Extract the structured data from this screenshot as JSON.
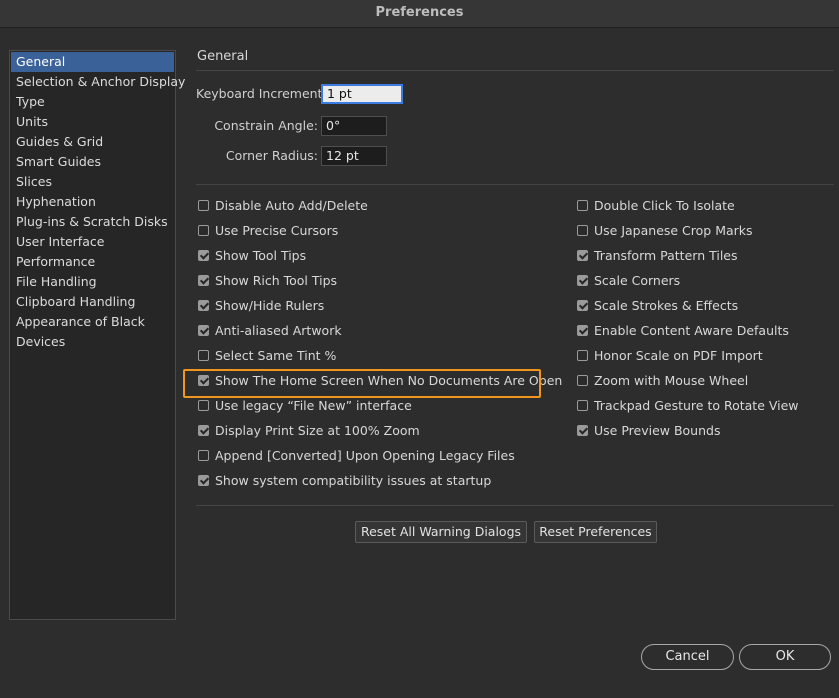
{
  "window": {
    "title": "Preferences"
  },
  "sidebar": {
    "items": [
      {
        "label": "General",
        "selected": true
      },
      {
        "label": "Selection & Anchor Display"
      },
      {
        "label": "Type"
      },
      {
        "label": "Units"
      },
      {
        "label": "Guides & Grid"
      },
      {
        "label": "Smart Guides"
      },
      {
        "label": "Slices"
      },
      {
        "label": "Hyphenation"
      },
      {
        "label": "Plug-ins & Scratch Disks"
      },
      {
        "label": "User Interface"
      },
      {
        "label": "Performance"
      },
      {
        "label": "File Handling"
      },
      {
        "label": "Clipboard Handling"
      },
      {
        "label": "Appearance of Black"
      },
      {
        "label": "Devices"
      }
    ]
  },
  "general": {
    "title": "General",
    "keyboard_increment": {
      "label": "Keyboard Increment:",
      "value": "1 pt"
    },
    "constrain_angle": {
      "label": "Constrain Angle:",
      "value": "0°"
    },
    "corner_radius": {
      "label": "Corner Radius:",
      "value": "12 pt"
    }
  },
  "options_left": [
    {
      "label": "Disable Auto Add/Delete",
      "checked": false
    },
    {
      "label": "Use Precise Cursors",
      "checked": false
    },
    {
      "label": "Show Tool Tips",
      "checked": true
    },
    {
      "label": "Show Rich Tool Tips",
      "checked": true
    },
    {
      "label": "Show/Hide Rulers",
      "checked": true
    },
    {
      "label": "Anti-aliased Artwork",
      "checked": true
    },
    {
      "label": "Select Same Tint %",
      "checked": false
    },
    {
      "label": "Show The Home Screen When No Documents Are Open",
      "checked": true
    },
    {
      "label": "Use legacy “File New” interface",
      "checked": false
    },
    {
      "label": "Display Print Size at 100% Zoom",
      "checked": true
    },
    {
      "label": "Append [Converted] Upon Opening Legacy Files",
      "checked": false
    },
    {
      "label": "Show system compatibility issues at startup",
      "checked": true
    }
  ],
  "options_right": [
    {
      "label": "Double Click To Isolate",
      "checked": false
    },
    {
      "label": "Use Japanese Crop Marks",
      "checked": false
    },
    {
      "label": "Transform Pattern Tiles",
      "checked": true
    },
    {
      "label": "Scale Corners",
      "checked": true
    },
    {
      "label": "Scale Strokes & Effects",
      "checked": true
    },
    {
      "label": "Enable Content Aware Defaults",
      "checked": true
    },
    {
      "label": "Honor Scale on PDF Import",
      "checked": false
    },
    {
      "label": "Zoom with Mouse Wheel",
      "checked": false
    },
    {
      "label": "Trackpad Gesture to Rotate View",
      "checked": false
    },
    {
      "label": "Use Preview Bounds",
      "checked": true
    }
  ],
  "buttons": {
    "reset_warnings": "Reset All Warning Dialogs",
    "reset_prefs": "Reset Preferences",
    "cancel": "Cancel",
    "ok": "OK"
  },
  "colors": {
    "selection": "#3b6199",
    "highlight_border": "#f0961e",
    "focus_ring": "#3c7be0"
  }
}
